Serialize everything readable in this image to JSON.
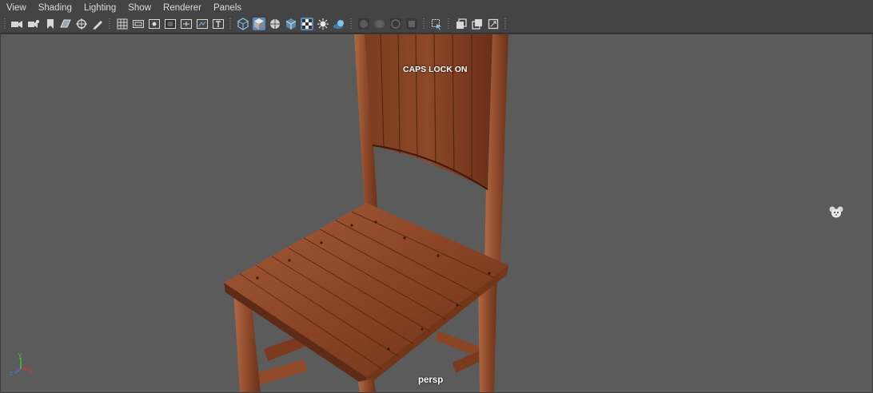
{
  "menu": {
    "items": [
      "View",
      "Shading",
      "Lighting",
      "Show",
      "Renderer",
      "Panels"
    ]
  },
  "toolbar": {
    "icons": [
      "select-camera-icon",
      "camera-attributes-icon",
      "bookmark-icon",
      "image-plane-icon",
      "2d-pan-zoom-icon",
      "grease-pencil-icon",
      "grid-icon",
      "film-gate-icon",
      "resolution-gate-icon",
      "gate-mask-icon",
      "field-chart-icon",
      "safe-action-icon",
      "safe-title-icon",
      "wireframe-icon",
      "smooth-shade-icon",
      "wireframe-on-shaded-icon",
      "xray-icon",
      "textured-icon",
      "use-default-light-icon",
      "shadows-icon",
      "screen-space-ao-icon",
      "motion-blur-icon",
      "multisample-aa-icon",
      "depth-of-field-icon",
      "isolate-select-icon",
      "xray-joints-icon",
      "xray-active-icon",
      "backface-culling-icon",
      "frame-all-icon"
    ]
  },
  "viewport": {
    "camera_label": "persp",
    "caps_lock_text": "CAPS LOCK ON",
    "axis": {
      "y": "y",
      "x": "x",
      "z": "z"
    }
  },
  "colors": {
    "ui_bg": "#444444",
    "viewport_bg": "#5b5b5b",
    "active_icon": "#5b8ab8",
    "axis_x": "#e03030",
    "axis_y": "#40c040",
    "axis_z": "#4070e0",
    "wood_light": "#a2593a",
    "wood_dark": "#5e2c16"
  }
}
